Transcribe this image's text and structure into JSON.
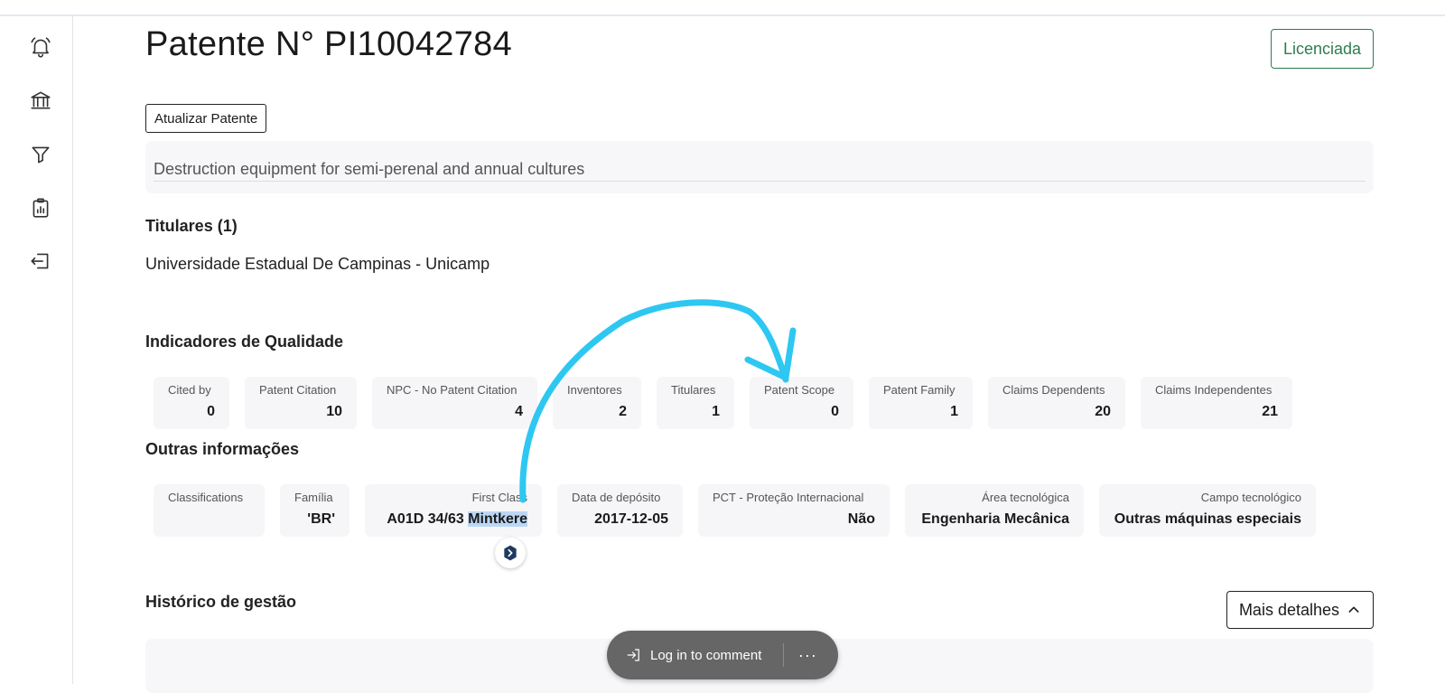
{
  "patent": {
    "title": "Patente N° PI10042784",
    "status": "Licenciada",
    "update_button": "Atualizar Patente",
    "description": "Destruction equipment for semi-perenal and annual cultures"
  },
  "sidebar": {
    "icons": [
      "bell-icon",
      "bank-icon",
      "filter-icon",
      "clipboard-chart-icon",
      "logout-icon"
    ]
  },
  "holders": {
    "heading": "Titulares (1)",
    "items": [
      "Universidade Estadual De Campinas - Unicamp"
    ]
  },
  "quality": {
    "heading": "Indicadores de Qualidade",
    "cards": [
      {
        "label": "Cited by",
        "value": "0"
      },
      {
        "label": "Patent Citation",
        "value": "10"
      },
      {
        "label": "NPC - No Patent Citation",
        "value": "4"
      },
      {
        "label": "Inventores",
        "value": "2"
      },
      {
        "label": "Titulares",
        "value": "1"
      },
      {
        "label": "Patent Scope",
        "value": "0"
      },
      {
        "label": "Patent Family",
        "value": "1"
      },
      {
        "label": "Claims Dependents",
        "value": "20"
      },
      {
        "label": "Claims Independentes",
        "value": "21"
      }
    ]
  },
  "other": {
    "heading": "Outras informações",
    "cards": [
      {
        "label": "Classifications",
        "value": ""
      },
      {
        "label": "Família",
        "value": "'BR'"
      },
      {
        "label": "First Class",
        "value": "A01D 34/63 ",
        "value_selected": "Mintkere"
      },
      {
        "label": "Data de depósito",
        "value": "2017-12-05"
      },
      {
        "label": "PCT - Proteção Internacional",
        "value": "Não"
      },
      {
        "label": "Área tecnológica",
        "value": "Engenharia Mecânica"
      },
      {
        "label": "Campo tecnológico",
        "value": "Outras máquinas especiais"
      }
    ]
  },
  "history": {
    "heading": "Histórico de gestão",
    "more_button": "Mais detalhes"
  },
  "comment_bar": {
    "login_label": "Log in to comment",
    "more_label": "···"
  },
  "colors": {
    "status_green": "#2e7d4f",
    "annotation_blue": "#2ec7f2",
    "card_bg": "#f6f6f8",
    "pill_bg": "#666666"
  }
}
